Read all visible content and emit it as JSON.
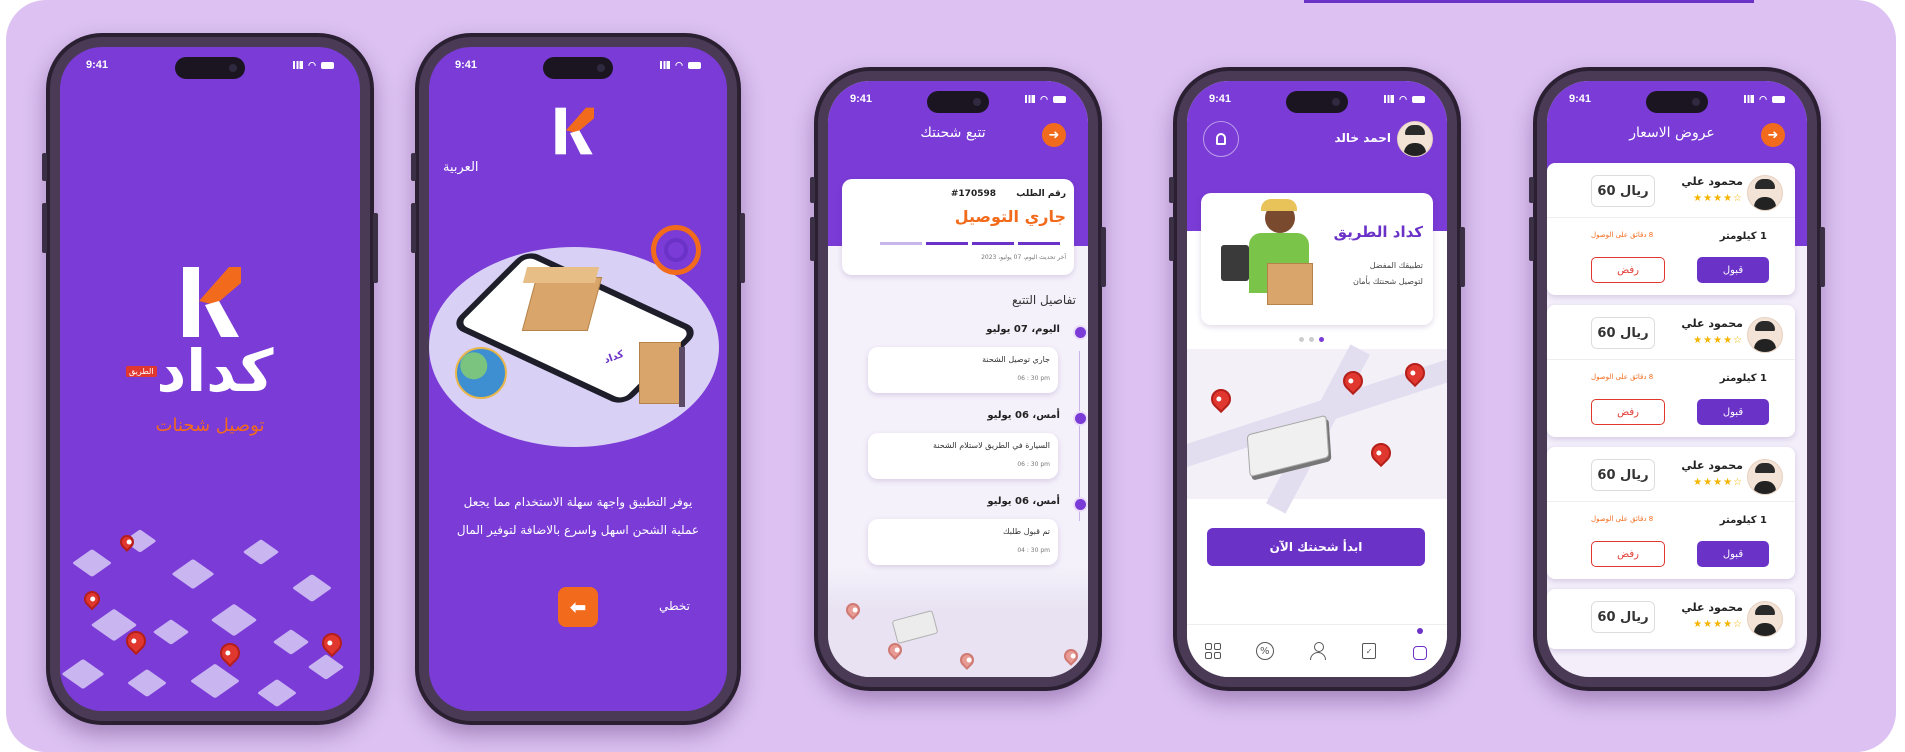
{
  "status_time": "9:41",
  "splash": {
    "brand": "كداد",
    "brand_tag": "الطريق",
    "tagline": "توصيل شحنات"
  },
  "onboarding": {
    "language": "العربية",
    "description_line1": "يوفر التطبيق واجهة سهلة الاستخدام مما يجعل",
    "description_line2": "عملية الشحن اسهل واسرع بالاضافة لتوفير المال",
    "skip": "تخطي",
    "next_icon": "arrow-left-icon",
    "illustration_badge": "كداد"
  },
  "tracking": {
    "title": "تتبع شحنتك",
    "order_label": "رقم الطلب",
    "order_number": "#170598",
    "status": "جاري التوصيل",
    "last_update": "آخر تحديث اليوم، 07 يوليو، 2023",
    "section_title": "تفاصيل التتبع",
    "progress_steps": 4,
    "progress_done": 3,
    "events": [
      {
        "date": "اليوم، 07 يوليو",
        "text": "جاري توصيل الشحنة",
        "time": "06 : 30 pm"
      },
      {
        "date": "أمس، 06 يوليو",
        "text": "السيارة في الطريق لاستلام الشحنة",
        "time": "06 : 30 pm"
      },
      {
        "date": "أمس، 06 يوليو",
        "text": "تم قبول طلبك",
        "time": "04 : 30 pm"
      }
    ]
  },
  "home": {
    "user_name": "احمد خالد",
    "banner_title": "كداد الطريق",
    "banner_line1": "تطبيقك المفضل",
    "banner_line2": "لتوصيل شحنتك بأمان",
    "cta": "ابدأ شحنتك الآن",
    "nav": [
      {
        "icon": "home-icon",
        "active": true
      },
      {
        "icon": "orders-icon",
        "active": false
      },
      {
        "icon": "profile-icon",
        "active": false
      },
      {
        "icon": "discount-icon",
        "active": false
      },
      {
        "icon": "grid-icon",
        "active": false
      }
    ]
  },
  "offers": {
    "title": "عروض الاسعار",
    "items": [
      {
        "name": "محمود علي",
        "price": "60 ريال",
        "distance": "1 كيلومتر",
        "eta": "8 دقائق على الوصول",
        "accept": "قبول",
        "reject": "رفض",
        "rating": "★★★★☆"
      },
      {
        "name": "محمود علي",
        "price": "60 ريال",
        "distance": "1 كيلومتر",
        "eta": "8 دقائق على الوصول",
        "accept": "قبول",
        "reject": "رفض",
        "rating": "★★★★☆"
      },
      {
        "name": "محمود علي",
        "price": "60 ريال",
        "distance": "1 كيلومتر",
        "eta": "8 دقائق على الوصول",
        "accept": "قبول",
        "reject": "رفض",
        "rating": "★★★★☆"
      },
      {
        "name": "محمود علي",
        "price": "60 ريال",
        "rating": "★★★★☆"
      }
    ]
  },
  "colors": {
    "brand_purple": "#7a3bd6",
    "accent_orange": "#f26b1d",
    "background": "#dcc1f2"
  }
}
